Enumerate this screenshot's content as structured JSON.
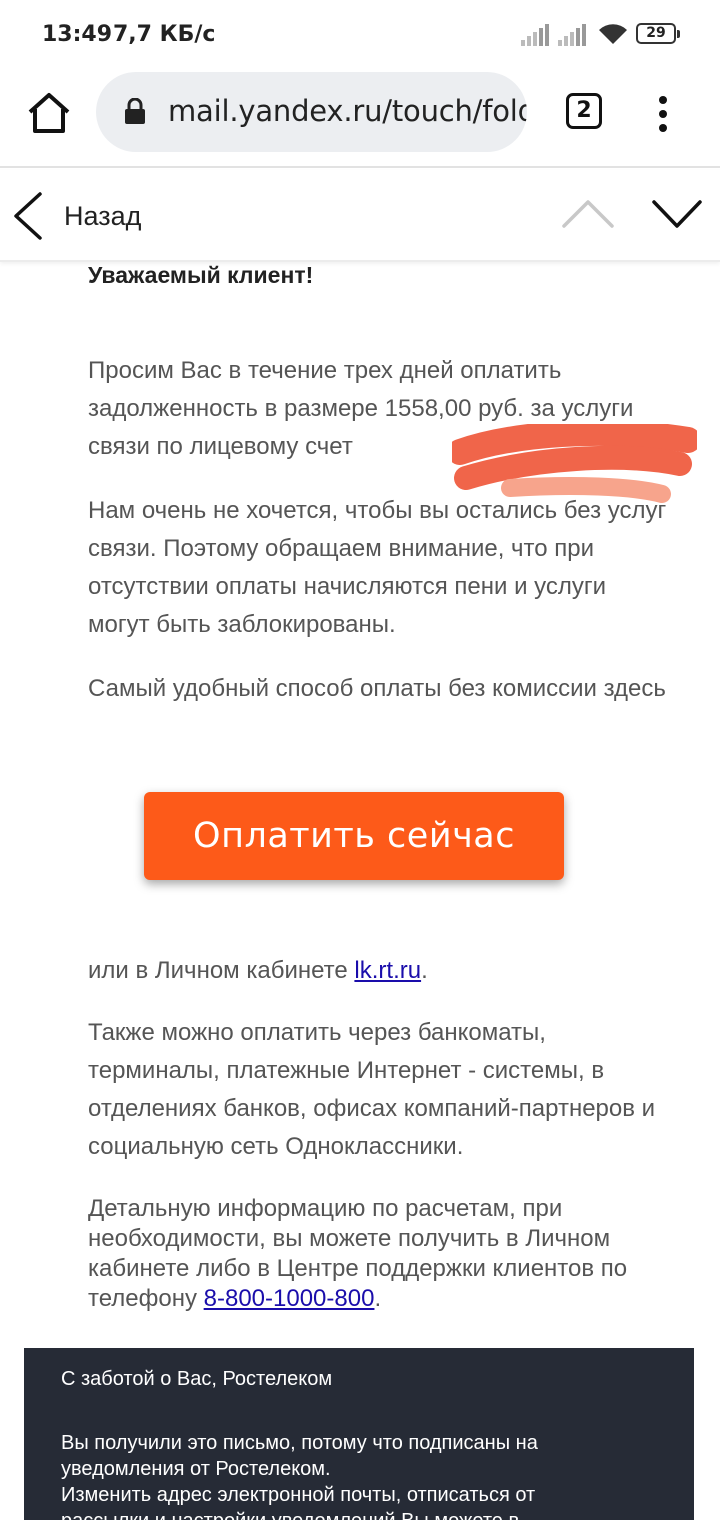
{
  "status_bar": {
    "time": "13:49",
    "speed": "7,7 КБ/с",
    "battery": "29"
  },
  "browser": {
    "url": "mail.yandex.ru/touch/folde",
    "tab_count": "2",
    "icons": [
      "home-icon",
      "lock-icon",
      "tabs-counter",
      "overflow-menu-icon"
    ]
  },
  "mail_nav": {
    "back_label": "Назад",
    "icons": [
      "chevron-left-icon",
      "chevron-up-icon",
      "chevron-down-icon"
    ]
  },
  "letter": {
    "greeting": "Уважаемый клиент!",
    "paragraph1": "Просим Вас в течение трех дней оплатить задолженность в размере 1558,00 руб. за услуги связи по лицевому счет",
    "paragraph2": "Нам очень не хочется, чтобы вы остались без услуг связи. Поэтому обращаем внимание, что при отсутствии оплаты начисляются пени и услуги могут быть заблокированы.",
    "paragraph3": "Самый удобный способ оплаты без комиссии здесь",
    "pay_button": "Оплатить сейчас",
    "lk_prefix": "или в Личном кабинете ",
    "lk_link": "lk.rt.ru",
    "lk_suffix": ".",
    "paragraph4": "Также можно оплатить через банкоматы, терминалы, платежные Интернет - системы, в отделениях банков, офисах компаний-партнеров и социальную сеть Одноклассники.",
    "paragraph5_prefix": "Детальную информацию по расчетам, при необходимости, вы можете получить в Личном кабинете либо в Центре поддержки клиентов по телефону ",
    "phone_link": "8-800-1000-800",
    "paragraph5_suffix": "."
  },
  "footer": {
    "signature": "С заботой о Вас, Ростелеком",
    "notice": "Вы получили это письмо, потому что подписаны на уведомления от Ростелеком.\nИзменить адрес электронной почты, отписаться от рассылки и настройки уведомлений Вы можете в"
  },
  "colors": {
    "pay_button": "#fd5a19",
    "footer_bg": "#262b36",
    "link": "#1a0dab",
    "redaction": "#f0654a"
  }
}
